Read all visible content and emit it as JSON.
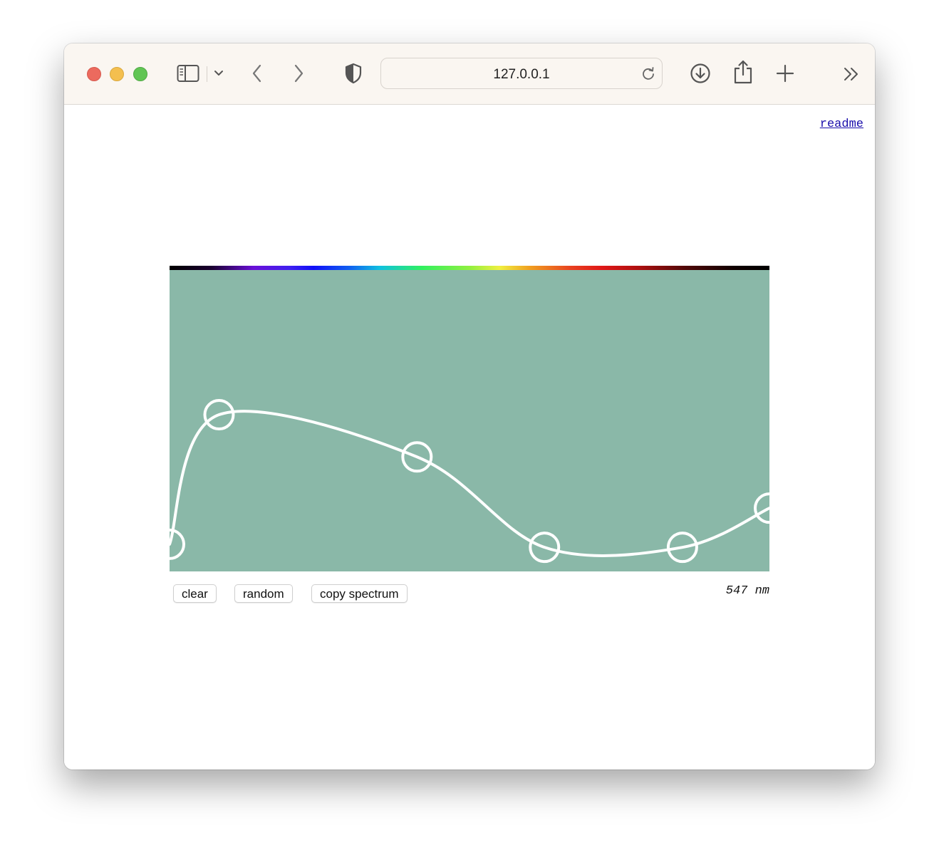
{
  "browser": {
    "address": "127.0.0.1",
    "icons": {
      "sidebar": "sidebar-icon",
      "sidebar_menu": "chevron-down-icon",
      "back": "chevron-left-icon",
      "forward": "chevron-right-icon",
      "privacy": "shield-icon",
      "reload": "reload-icon",
      "downloads": "download-icon",
      "share": "share-icon",
      "new_tab": "plus-icon",
      "more": "double-chevron-right-icon"
    }
  },
  "page": {
    "readme_link": "readme",
    "buttons": {
      "clear": "clear",
      "random": "random",
      "copy": "copy spectrum"
    },
    "wavelength_readout": "547 nm"
  },
  "spectrum": {
    "background_color": "#8ab8a8",
    "curve_color": "#ffffff",
    "control_points": [
      {
        "wavelength": 380,
        "intensity": 0.09
      },
      {
        "wavelength": 413,
        "intensity": 0.52
      },
      {
        "wavelength": 545,
        "intensity": 0.38
      },
      {
        "wavelength": 630,
        "intensity": 0.08
      },
      {
        "wavelength": 722,
        "intensity": 0.08
      },
      {
        "wavelength": 780,
        "intensity": 0.21
      }
    ],
    "wavelength_range": [
      380,
      780
    ],
    "intensity_range": [
      0,
      1
    ]
  }
}
